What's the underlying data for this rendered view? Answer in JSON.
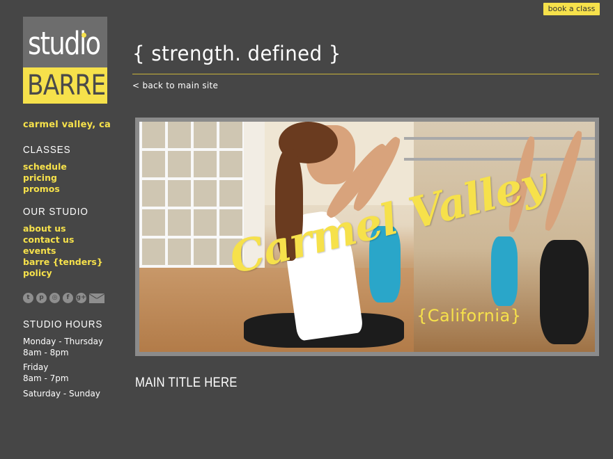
{
  "header": {
    "book_label": "book a class",
    "tagline": "{ strength. defined }",
    "back_link": "< back to main site"
  },
  "logo": {
    "top": "studio",
    "bottom": "BARRE"
  },
  "sidebar": {
    "location": "carmel valley, ca",
    "classes_heading": "CLASSES",
    "classes_links": [
      "schedule",
      "pricing",
      "promos"
    ],
    "studio_heading": "OUR STUDIO",
    "studio_links": [
      "about us",
      "contact us",
      "events",
      "barre {tenders}",
      "policy"
    ],
    "social_icons": [
      "twitter-icon",
      "pinterest-icon",
      "instagram-icon",
      "facebook-icon",
      "google-plus-icon",
      "mail-icon"
    ],
    "hours_heading": "STUDIO HOURS",
    "hours": [
      {
        "days": "Monday - Thursday",
        "time": "8am - 8pm"
      },
      {
        "days": "Friday",
        "time": "8am - 7pm"
      },
      {
        "days": "Saturday - Sunday",
        "time": ""
      }
    ]
  },
  "hero": {
    "script_text": "Carmel Valley",
    "sub_text": "{California}"
  },
  "main": {
    "title": "MAIN TITLE HERE"
  },
  "colors": {
    "background": "#464646",
    "accent": "#f6e14b",
    "logo_gray": "#6d6d6d"
  }
}
